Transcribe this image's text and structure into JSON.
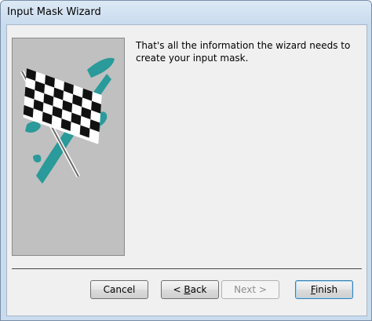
{
  "window": {
    "title": "Input Mask Wizard"
  },
  "content": {
    "message": "That's all the information the wizard needs to create your input mask."
  },
  "buttons": {
    "cancel": {
      "label": "Cancel"
    },
    "back": {
      "prefix": "< ",
      "mnemonic": "B",
      "rest": "ack"
    },
    "next": {
      "label": "Next >"
    },
    "finish": {
      "mnemonic": "F",
      "rest": "inish"
    }
  },
  "colors": {
    "flag_teal": "#2a9a9a",
    "panel_gray": "#c0c0c0"
  },
  "icons": {
    "wizard_picture": "checkered-flag-icon"
  }
}
